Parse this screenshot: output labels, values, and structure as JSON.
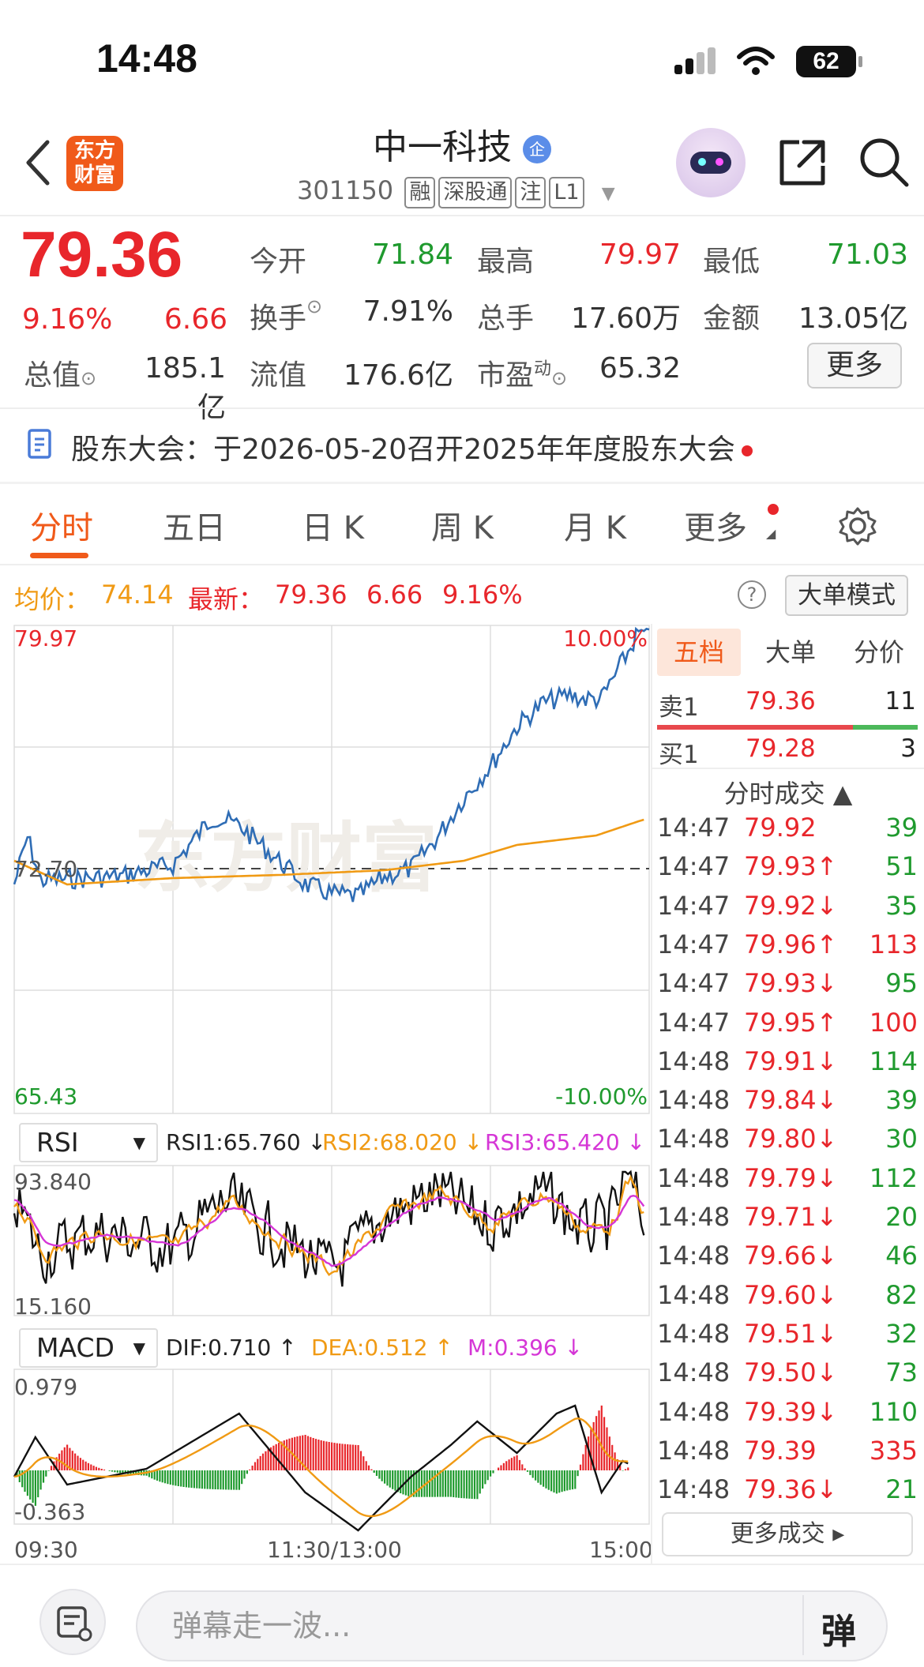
{
  "status": {
    "time": "14:48",
    "battery": "62"
  },
  "header": {
    "stock_name": "中一科技",
    "stock_code": "301150",
    "tags": [
      "融",
      "深股通",
      "注",
      "L1"
    ],
    "logo_text_1": "东方",
    "logo_text_2": "财富"
  },
  "quote": {
    "price": "79.36",
    "change_pct": "9.16%",
    "change": "6.66",
    "open_label": "今开",
    "open": "71.84",
    "high_label": "最高",
    "high": "79.97",
    "low_label": "最低",
    "low": "71.03",
    "turnover_label": "换手",
    "turnover": "7.91%",
    "volume_label": "总手",
    "volume": "17.60万",
    "amount_label": "金额",
    "amount": "13.05亿",
    "total_cap_label": "总值",
    "total_cap": "185.1亿",
    "float_cap_label": "流值",
    "float_cap": "176.6亿",
    "pe_label": "市盈",
    "pe_sup": "动",
    "pe": "65.32",
    "more_button": "更多"
  },
  "notice": {
    "text": "股东大会：于2026-05-20召开2025年年度股东大会"
  },
  "tabs": [
    "分时",
    "五日",
    "日 K",
    "周 K",
    "月 K",
    "更多"
  ],
  "info_line": {
    "avg_label": "均价：",
    "avg": "74.14",
    "latest_label": "最新：",
    "latest": "79.36",
    "change": "6.66",
    "change_pct": "9.16%",
    "help_icon": "?",
    "mode_button": "大单模式"
  },
  "main_chart": {
    "top_price": "79.97",
    "top_pct": "10.00%",
    "bottom_price": "65.43",
    "bottom_pct": "-10.00%",
    "prev_close": "72.70",
    "time_labels": [
      "09:30",
      "11:30/13:00",
      "15:00"
    ]
  },
  "rsi": {
    "select": "RSI",
    "rsi1": "RSI1:65.760 ↓",
    "rsi2": "RSI2:68.020 ↓",
    "rsi3": "RSI3:65.420 ↓",
    "max": "93.840",
    "min": "15.160"
  },
  "macd": {
    "select": "MACD",
    "dif": "DIF:0.710 ↑",
    "dea": "DEA:0.512 ↑",
    "m": "M:0.396 ↓",
    "max": "0.979",
    "min": "-0.363"
  },
  "right_panel": {
    "tabs": [
      "五档",
      "大单",
      "分价"
    ],
    "sell1_label": "卖1",
    "sell1_price": "79.36",
    "sell1_vol": "11",
    "buy1_label": "买1",
    "buy1_price": "79.28",
    "buy1_vol": "3",
    "trades_title": "分时成交 ▲",
    "trades": [
      {
        "t": "14:47",
        "p": "79.92",
        "v": "39",
        "pc": "red",
        "vc": "green"
      },
      {
        "t": "14:47",
        "p": "79.93↑",
        "v": "51",
        "pc": "red",
        "vc": "green"
      },
      {
        "t": "14:47",
        "p": "79.92↓",
        "v": "35",
        "pc": "red",
        "vc": "green"
      },
      {
        "t": "14:47",
        "p": "79.96↑",
        "v": "113",
        "pc": "red",
        "vc": "red"
      },
      {
        "t": "14:47",
        "p": "79.93↓",
        "v": "95",
        "pc": "red",
        "vc": "green"
      },
      {
        "t": "14:47",
        "p": "79.95↑",
        "v": "100",
        "pc": "red",
        "vc": "red"
      },
      {
        "t": "14:48",
        "p": "79.91↓",
        "v": "114",
        "pc": "red",
        "vc": "green"
      },
      {
        "t": "14:48",
        "p": "79.84↓",
        "v": "39",
        "pc": "red",
        "vc": "green"
      },
      {
        "t": "14:48",
        "p": "79.80↓",
        "v": "30",
        "pc": "red",
        "vc": "green"
      },
      {
        "t": "14:48",
        "p": "79.79↓",
        "v": "112",
        "pc": "red",
        "vc": "green"
      },
      {
        "t": "14:48",
        "p": "79.71↓",
        "v": "20",
        "pc": "red",
        "vc": "green"
      },
      {
        "t": "14:48",
        "p": "79.66↓",
        "v": "46",
        "pc": "red",
        "vc": "green"
      },
      {
        "t": "14:48",
        "p": "79.60↓",
        "v": "82",
        "pc": "red",
        "vc": "green"
      },
      {
        "t": "14:48",
        "p": "79.51↓",
        "v": "32",
        "pc": "red",
        "vc": "green"
      },
      {
        "t": "14:48",
        "p": "79.50↓",
        "v": "73",
        "pc": "red",
        "vc": "green"
      },
      {
        "t": "14:48",
        "p": "79.39↓",
        "v": "110",
        "pc": "red",
        "vc": "green"
      },
      {
        "t": "14:48",
        "p": "79.39",
        "v": "335",
        "pc": "red",
        "vc": "red"
      },
      {
        "t": "14:48",
        "p": "79.36↓",
        "v": "21",
        "pc": "red",
        "vc": "green"
      }
    ],
    "more_trades": "更多成交 ▸"
  },
  "bottom": {
    "placeholder": "弹幕走一波...",
    "danmu_button": "弹"
  },
  "colors": {
    "up": "#e8262b",
    "down": "#1f9a2e",
    "accent": "#f05a1a",
    "avg_line": "#f09a14",
    "price_line": "#2f6db5"
  }
}
